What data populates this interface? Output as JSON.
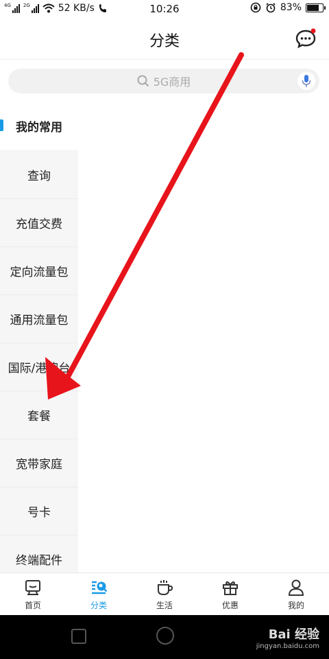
{
  "status_bar": {
    "left_signal_labels": [
      "4G",
      "2G"
    ],
    "net_speed": "52 KB/s",
    "time": "10:26",
    "battery": "83%",
    "battery_level": 0.83
  },
  "header": {
    "title": "分类"
  },
  "search": {
    "placeholder": "5G商用"
  },
  "sidebar": {
    "items": [
      {
        "label": "我的常用",
        "active": true
      },
      {
        "label": "查询"
      },
      {
        "label": "充值交费"
      },
      {
        "label": "定向流量包"
      },
      {
        "label": "通用流量包"
      },
      {
        "label": "国际/港澳台"
      },
      {
        "label": "套餐"
      },
      {
        "label": "宽带家庭"
      },
      {
        "label": "号卡"
      },
      {
        "label": "终端配件"
      }
    ]
  },
  "bottom_nav": {
    "items": [
      {
        "label": "首页",
        "icon": "home-icon"
      },
      {
        "label": "分类",
        "icon": "category-icon",
        "active": true
      },
      {
        "label": "生活",
        "icon": "cup-icon"
      },
      {
        "label": "优惠",
        "icon": "gift-icon"
      },
      {
        "label": "我的",
        "icon": "user-icon"
      }
    ]
  },
  "watermark": {
    "text": "Bai 经验",
    "url_text": "jingyan.baidu.com"
  },
  "colors": {
    "accent": "#1a9ae6",
    "arrow": "#e8141b",
    "notify_dot": "#e8141b"
  }
}
